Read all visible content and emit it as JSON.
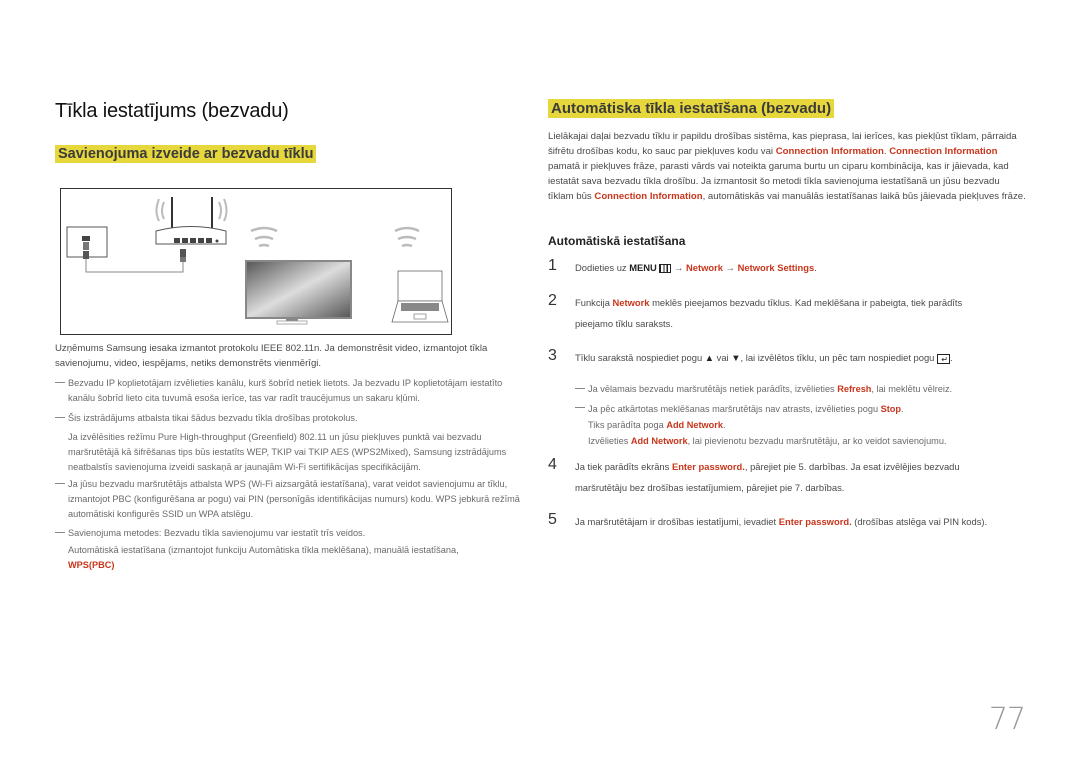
{
  "page": {
    "title": "Tīkla iestatījums (bezvadu)",
    "page_number": "77"
  },
  "left": {
    "subtitle": "Savienojuma izveide ar bezvadu tīklu",
    "figure_label": "Wireless network diagram: wall LAN port, wireless router, display, laptop",
    "intro": "Uzņēmums Samsung iesaka izmantot protokolu IEEE 802.11n. Ja demonstrēsit video, izmantojot tīkla savienojumu, video, iespējams, netiks demonstrēts vienmērīgi.",
    "notes": [
      {
        "text": "Bezvadu IP koplietotājam izvēlieties kanālu, kurš šobrīd netiek lietots. Ja bezvadu IP koplietotājam iestatīto kanālu šobrīd lieto cita tuvumā esoša ierīce, tas var radīt traucējumus un sakaru kļūmi."
      },
      {
        "text": "Šis izstrādājums atbalsta tikai šādus bezvadu tīkla drošības protokolus.",
        "extra": "Ja izvēlēsities režīmu Pure High-throughput (Greenfield) 802.11 un jūsu piekļuves punktā vai bezvadu maršrutētājā kā šifrēšanas tips būs iestatīts WEP, TKIP vai TKIP AES (WPS2Mixed), Samsung izstrādājums neatbalstīs savienojuma izveidi saskaņā ar jaunajām Wi-Fi sertifikācijas specifikācijām."
      },
      {
        "text": "Ja jūsu bezvadu maršrutētājs atbalsta WPS (Wi-Fi aizsargātā iestatīšana), varat veidot savienojumu ar tīklu, izmantojot PBC (konfigurēšana ar pogu) vai PIN (personīgās identifikācijas numurs) kodu. WPS jebkurā režīmā automātiski konfigurēs SSID un WPA atslēgu."
      },
      {
        "text": "Savienojuma metodes: Bezvadu tīkla savienojumu var iestatīt trīs veidos.",
        "extra": "Automātiskā iestatīšana (izmantojot funkciju Automātiska tīkla meklēšana), manuālā iestatīšana,",
        "extra_highlight": "WPS(PBC)"
      }
    ]
  },
  "right": {
    "subtitle": "Automātiska tīkla iestatīšana (bezvadu)",
    "intro": {
      "p1": "Lielākajai daļai bezvadu tīklu ir papildu drošības sistēma, kas pieprasa, lai ierīces, kas piekļūst tīklam, pārraida šifrētu drošības kodu, ko sauc par piekļuves kodu vai ",
      "hl1": "Connection Information",
      "p2": ". ",
      "hl2": "Connection Information",
      "p3": " pamatā ir piekļuves frāze, parasti vārds vai noteikta garuma burtu un ciparu kombinācija, kas ir jāievada, kad iestatāt sava bezvadu tīkla drošību. Ja izmantosit šo metodi tīkla savienojuma iestatīšanā un jūsu bezvadu tīklam būs ",
      "hl3": "Connection Information",
      "p4": ", automātiskās vai manuālās iestatīšanas laikā būs jāievada piekļuves frāze."
    },
    "section_title": "Automātiskā iestatīšana",
    "steps": [
      {
        "num": "1",
        "a": "Dodieties uz ",
        "menu": "MENU",
        "arrow": " → ",
        "hl1": "Network",
        "hl2": "Network Settings",
        "end": "."
      },
      {
        "num": "2",
        "a": "Funkcija ",
        "hl1": "Network",
        "b": " meklēs pieejamos bezvadu tīklus. Kad meklēšana ir pabeigta, tiek parādīts pieejamo tīklu saraksts."
      },
      {
        "num": "3",
        "a": "Tīklu sarakstā nospiediet pogu ",
        "up": "▲",
        "vai": " vai ",
        "down": "▼",
        "b": ", lai izvēlētos tīklu, un pēc tam nospiediet pogu ",
        "end": "."
      },
      {
        "num": "4",
        "a": "Ja tiek parādīts ekrāns ",
        "hl1": "Enter password.",
        "b": ", pārejiet pie 5. darbības. Ja esat izvēlējies bezvadu maršrutētāju bez drošības iestatījumiem, pārejiet pie 7. darbības."
      },
      {
        "num": "5",
        "a": "Ja maršrutētājam ir drošības iestatījumi, ievadiet ",
        "hl1": "Enter password.",
        "b": " (drošības atslēga vai PIN kods)."
      }
    ],
    "step3_notes": {
      "n1a": "Ja vēlamais bezvadu maršrutētājs netiek parādīts, izvēlieties ",
      "n1hl": "Refresh",
      "n1b": ", lai meklētu vēlreiz.",
      "n2a": "Ja pēc atkārtotas meklēšanas maršrutētājs nav atrasts, izvēlieties pogu ",
      "n2hl": "Stop",
      "n2b": ".",
      "n2c": "Tiks parādīta poga ",
      "n2chl": "Add Network",
      "n2cend": ".",
      "n2d": "Izvēlieties ",
      "n2dhl": "Add Network",
      "n2db": ", lai pievienotu bezvadu maršrutētāju, ar ko veidot savienojumu."
    }
  },
  "colors": {
    "highlight": "#e6d73c",
    "accent_red": "#c8361c"
  }
}
